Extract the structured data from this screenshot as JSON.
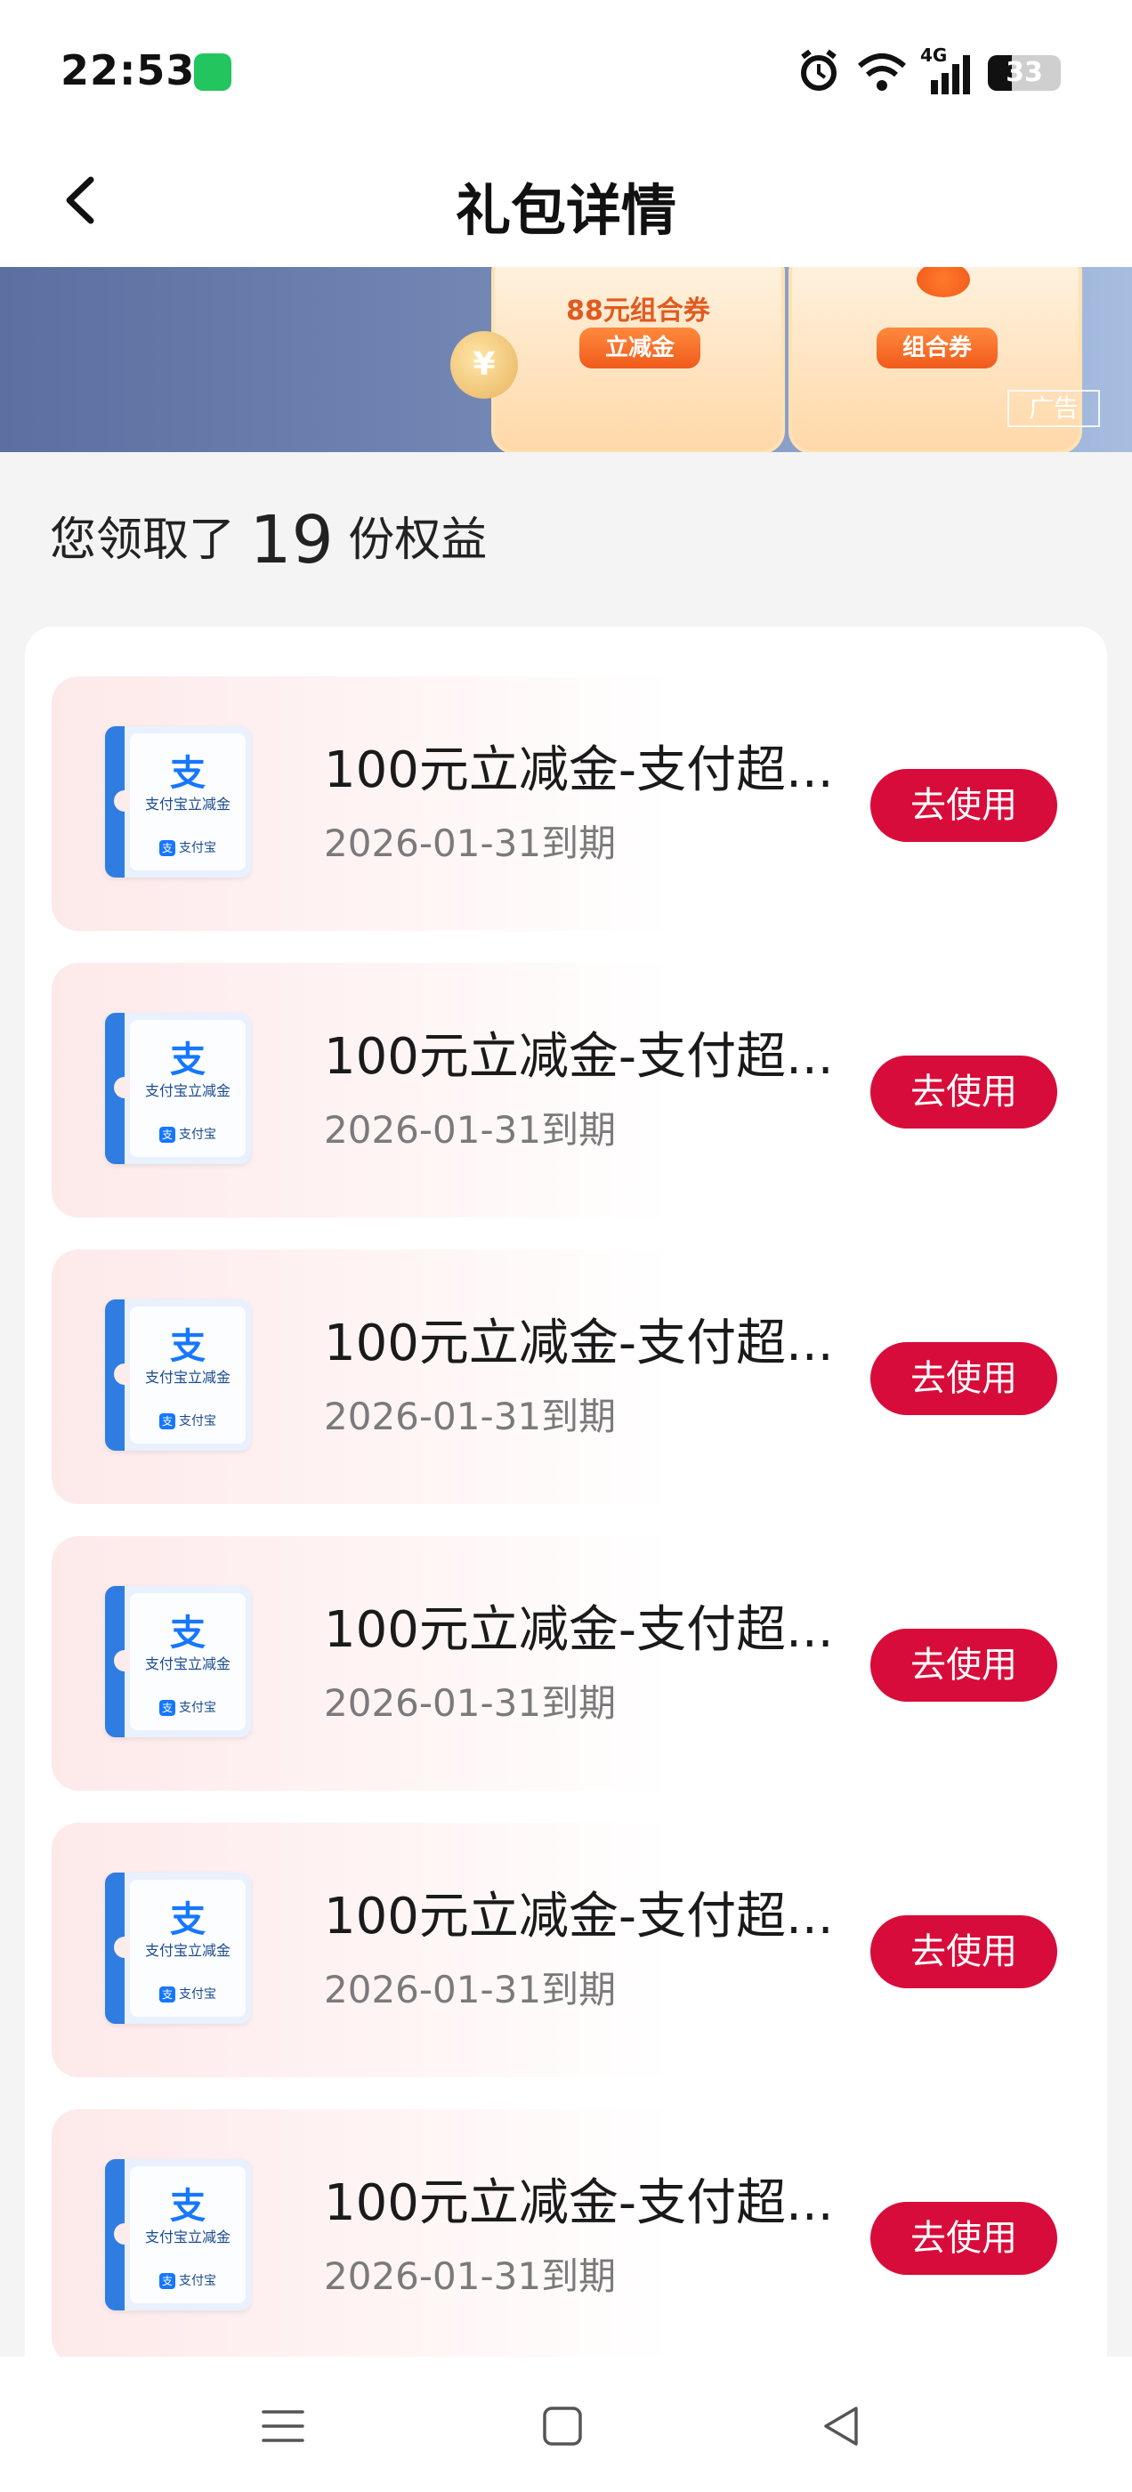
{
  "status_bar": {
    "time": "22:53",
    "network": "4G",
    "battery": "33",
    "battery_level": 0.33,
    "icons": [
      "wechat-icon",
      "alarm-icon",
      "wifi-icon",
      "cellular-signal-icon",
      "battery-icon"
    ]
  },
  "nav": {
    "title": "礼包详情",
    "back_icon": "chevron-left-icon"
  },
  "ad_banner": {
    "card_1_amount": "88元组合券",
    "card_1_label": "立减金",
    "card_2_label": "组合券",
    "coin_symbol": "¥",
    "ad_label": "广告"
  },
  "summary": {
    "prefix": "您领取了",
    "count": "19",
    "suffix": "份权益"
  },
  "coupons": [
    {
      "title": "100元立减金-支付超...",
      "expiry": "2026-01-31到期",
      "button": "去使用",
      "icon_glyph": "支",
      "icon_caption": "支付宝立减金",
      "icon_brand": "支付宝"
    },
    {
      "title": "100元立减金-支付超...",
      "expiry": "2026-01-31到期",
      "button": "去使用",
      "icon_glyph": "支",
      "icon_caption": "支付宝立减金",
      "icon_brand": "支付宝"
    },
    {
      "title": "100元立减金-支付超...",
      "expiry": "2026-01-31到期",
      "button": "去使用",
      "icon_glyph": "支",
      "icon_caption": "支付宝立减金",
      "icon_brand": "支付宝"
    },
    {
      "title": "100元立减金-支付超...",
      "expiry": "2026-01-31到期",
      "button": "去使用",
      "icon_glyph": "支",
      "icon_caption": "支付宝立减金",
      "icon_brand": "支付宝"
    },
    {
      "title": "100元立减金-支付超...",
      "expiry": "2026-01-31到期",
      "button": "去使用",
      "icon_glyph": "支",
      "icon_caption": "支付宝立减金",
      "icon_brand": "支付宝"
    },
    {
      "title": "100元立减金-支付超...",
      "expiry": "2026-01-31到期",
      "button": "去使用",
      "icon_glyph": "支",
      "icon_caption": "支付宝立减金",
      "icon_brand": "支付宝"
    }
  ],
  "system_nav": {
    "icons": [
      "menu-icon",
      "home-square-icon",
      "back-triangle-icon"
    ]
  },
  "colors": {
    "accent": "#d80c3a",
    "alipay_blue": "#1677ff",
    "page_background": "#f4f4f4"
  }
}
